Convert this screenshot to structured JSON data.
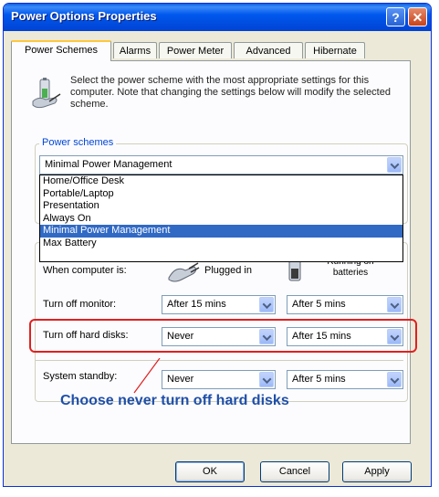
{
  "window": {
    "title": "Power Options Properties",
    "help_label": "?",
    "close_label": "✕"
  },
  "tabs": [
    "Power Schemes",
    "Alarms",
    "Power Meter",
    "Advanced",
    "Hibernate"
  ],
  "description": "Select the power scheme with the most appropriate settings for this computer. Note that changing the settings below will modify the selected scheme.",
  "power_schemes": {
    "group_label": "Power schemes",
    "selected": "Minimal Power Management",
    "options": [
      "Home/Office Desk",
      "Portable/Laptop",
      "Presentation",
      "Always On",
      "Minimal Power Management",
      "Max Battery"
    ]
  },
  "settings": {
    "when_label": "When computer is:",
    "plugged_label": "Plugged in",
    "battery_label": "Running on batteries",
    "monitor": {
      "label": "Turn off monitor:",
      "plugged": "After 15 mins",
      "battery": "After 5 mins"
    },
    "hard_disks": {
      "label": "Turn off hard disks:",
      "plugged": "Never",
      "battery": "After 15 mins"
    },
    "standby": {
      "label": "System standby:",
      "plugged": "Never",
      "battery": "After 5 mins"
    }
  },
  "annotation": "Choose never turn off hard disks",
  "buttons": {
    "ok": "OK",
    "cancel": "Cancel",
    "apply": "Apply"
  },
  "colors": {
    "title_bar": "#0054e3",
    "highlight_box": "#e02020",
    "annotation_text": "#1f4fa8",
    "selection": "#316ac5"
  }
}
